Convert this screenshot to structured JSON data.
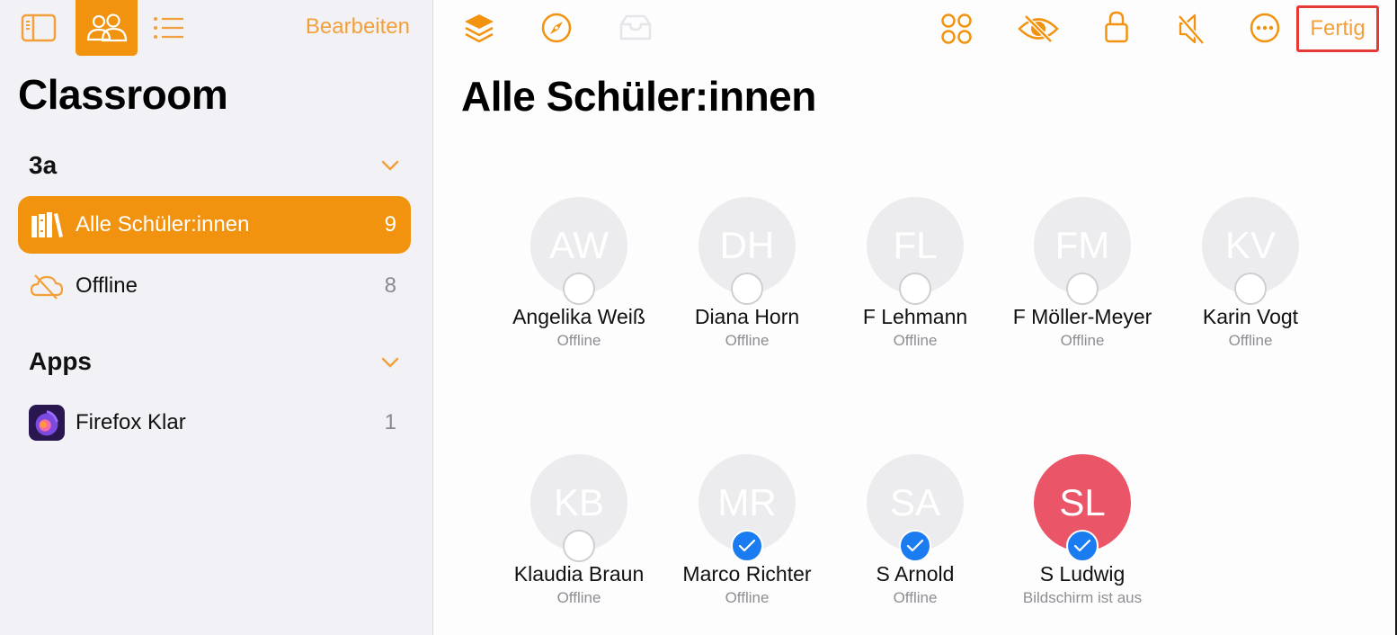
{
  "sidebar": {
    "edit_label": "Bearbeiten",
    "title": "Classroom",
    "sections": [
      {
        "title": "3a",
        "items": [
          {
            "label": "Alle Schüler:innen",
            "count": "9",
            "icon": "books-icon",
            "active": true
          },
          {
            "label": "Offline",
            "count": "8",
            "icon": "cloud-slash-icon",
            "active": false
          }
        ]
      },
      {
        "title": "Apps",
        "items": [
          {
            "label": "Firefox Klar",
            "count": "1",
            "icon": "firefox-focus-app-icon",
            "active": false
          }
        ]
      }
    ],
    "toolbar_icons": [
      "sidebar-toggle-icon",
      "people-icon",
      "list-icon"
    ]
  },
  "main": {
    "title": "Alle Schüler:innen",
    "toolbar_left": [
      "layers-icon",
      "compass-icon",
      "tray-icon"
    ],
    "toolbar_right": [
      "grid-icon",
      "eye-slash-icon",
      "lock-icon",
      "mute-icon",
      "more-icon"
    ],
    "done_label": "Fertig",
    "students": [
      {
        "initials": "AW",
        "name": "Angelika Weiß",
        "status": "Offline",
        "selected": false,
        "highlight": false
      },
      {
        "initials": "DH",
        "name": "Diana Horn",
        "status": "Offline",
        "selected": false,
        "highlight": false
      },
      {
        "initials": "FL",
        "name": "F Lehmann",
        "status": "Offline",
        "selected": false,
        "highlight": false
      },
      {
        "initials": "FM",
        "name": "F Möller-Meyer",
        "status": "Offline",
        "selected": false,
        "highlight": false
      },
      {
        "initials": "KV",
        "name": "Karin Vogt",
        "status": "Offline",
        "selected": false,
        "highlight": false
      },
      {
        "initials": "KB",
        "name": "Klaudia Braun",
        "status": "Offline",
        "selected": false,
        "highlight": false
      },
      {
        "initials": "MR",
        "name": "Marco Richter",
        "status": "Offline",
        "selected": true,
        "highlight": false
      },
      {
        "initials": "SA",
        "name": "S Arnold",
        "status": "Offline",
        "selected": true,
        "highlight": false
      },
      {
        "initials": "SL",
        "name": "S Ludwig",
        "status": "Bildschirm ist aus",
        "selected": true,
        "highlight": true
      }
    ]
  },
  "colors": {
    "accent": "#f2930f",
    "selected": "#1a7cf0",
    "highlight_avatar": "#ea5567",
    "done_outline": "#e53935"
  }
}
